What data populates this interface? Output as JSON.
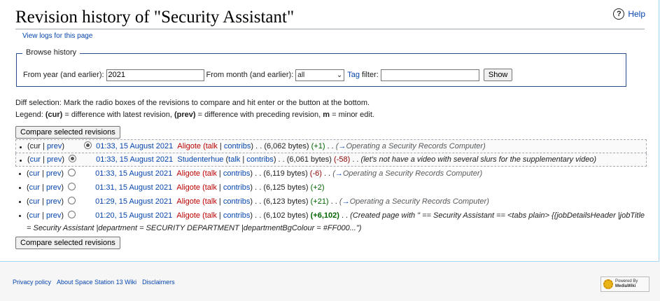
{
  "page": {
    "title": "Revision history of \"Security Assistant\"",
    "help_label": "Help",
    "view_logs": "View logs for this page"
  },
  "browse": {
    "legend": "Browse history",
    "year_label": "From year (and earlier):",
    "year_value": "2021",
    "month_label": "From month (and earlier):",
    "month_value": "all",
    "tag_link": "Tag",
    "tag_label": "filter:",
    "tag_value": "",
    "show_button": "Show"
  },
  "info": {
    "diff_selection": "Diff selection: Mark the radio boxes of the revisions to compare and hit enter or the button at the bottom.",
    "legend_prefix": "Legend:",
    "legend_cur": "(cur)",
    "legend_cur_desc": "= difference with latest revision,",
    "legend_prev": "(prev)",
    "legend_prev_desc": "= difference with preceding revision,",
    "legend_m": "m",
    "legend_m_desc": "= minor edit."
  },
  "compare_button": "Compare selected revisions",
  "revisions": [
    {
      "cur": "cur",
      "prev": "prev",
      "date": "01:33, 15 August 2021",
      "user": "Aligote",
      "talk": "talk",
      "contribs": "contribs",
      "bytes": "(6,062 bytes)",
      "diff": "(+1)",
      "summary": "Operating a Security Records Computer"
    },
    {
      "cur": "cur",
      "prev": "prev",
      "date": "01:33, 15 August 2021",
      "user": "Studenterhue",
      "talk": "talk",
      "contribs": "contribs",
      "bytes": "(6,061 bytes)",
      "diff": "(-58)",
      "summary": "(let's not have a video with several slurs for the supplementary video)"
    },
    {
      "cur": "cur",
      "prev": "prev",
      "date": "01:33, 15 August 2021",
      "user": "Aligote",
      "talk": "talk",
      "contribs": "contribs",
      "bytes": "(6,119 bytes)",
      "diff": "(-6)",
      "summary": "Operating a Security Records Computer"
    },
    {
      "cur": "cur",
      "prev": "prev",
      "date": "01:31, 15 August 2021",
      "user": "Aligote",
      "talk": "talk",
      "contribs": "contribs",
      "bytes": "(6,125 bytes)",
      "diff": "(+2)",
      "summary": ""
    },
    {
      "cur": "cur",
      "prev": "prev",
      "date": "01:29, 15 August 2021",
      "user": "Aligote",
      "talk": "talk",
      "contribs": "contribs",
      "bytes": "(6,123 bytes)",
      "diff": "(+21)",
      "summary": "Operating a Security Records Computer"
    },
    {
      "cur": "cur",
      "prev": "prev",
      "date": "01:20, 15 August 2021",
      "user": "Aligote",
      "talk": "talk",
      "contribs": "contribs",
      "bytes": "(6,102 bytes)",
      "diff": "(+6,102)",
      "summary": "(Created page with \" == Security Assistant == <tabs plain> {{jobDetailsHeader |jobTitle = Security Assistant |department = SECURITY DEPARTMENT |departmentBgColour = #FF000...\")"
    }
  ],
  "footer": {
    "privacy": "Privacy policy",
    "about": "About Space Station 13 Wiki",
    "disclaimers": "Disclaimers",
    "badge_line1": "Powered By",
    "badge_line2": "MediaWiki"
  }
}
